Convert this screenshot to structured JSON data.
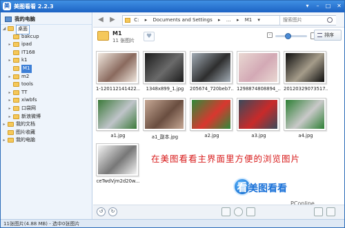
{
  "window": {
    "app_icon_text": "美",
    "title": "美图看看 2.2.3",
    "controls": [
      "▾",
      "–",
      "□",
      "✕"
    ]
  },
  "sidebar": {
    "header": "我的电脑",
    "tree": [
      {
        "label": "桌面",
        "indent": 0,
        "arrow": "◢",
        "state": "hl"
      },
      {
        "label": "bakcup",
        "indent": 1,
        "arrow": "",
        "state": ""
      },
      {
        "label": "ipad",
        "indent": 1,
        "arrow": "▸",
        "state": ""
      },
      {
        "label": "IT168",
        "indent": 1,
        "arrow": "",
        "state": ""
      },
      {
        "label": "k1",
        "indent": 1,
        "arrow": "▸",
        "state": ""
      },
      {
        "label": "M1",
        "indent": 1,
        "arrow": "",
        "state": "sel"
      },
      {
        "label": "m2",
        "indent": 1,
        "arrow": "▸",
        "state": ""
      },
      {
        "label": "tools",
        "indent": 1,
        "arrow": "",
        "state": ""
      },
      {
        "label": "TT",
        "indent": 1,
        "arrow": "▸",
        "state": ""
      },
      {
        "label": "xiwbfs",
        "indent": 1,
        "arrow": "▸",
        "state": ""
      },
      {
        "label": "口袋网",
        "indent": 1,
        "arrow": "▸",
        "state": ""
      },
      {
        "label": "新浪微博",
        "indent": 1,
        "arrow": "▸",
        "state": ""
      },
      {
        "label": "我的文档",
        "indent": 0,
        "arrow": "▸",
        "state": ""
      },
      {
        "label": "图片收藏",
        "indent": 0,
        "arrow": "",
        "state": ""
      },
      {
        "label": "我的电脑",
        "indent": 0,
        "arrow": "▸",
        "state": ""
      }
    ]
  },
  "navigation": {
    "back": "◀",
    "forward": "▶",
    "breadcrumb": [
      "C:",
      "▸",
      "Documents and Settings",
      "▸",
      "…",
      "▸",
      "M1",
      "▾"
    ],
    "search_placeholder": "搜索图片"
  },
  "folder": {
    "name": "M1",
    "count": "11 张图片",
    "heart": "♥",
    "sort_label": "排序",
    "zoom_out": "-"
  },
  "thumbnails": [
    {
      "caption": "1-120112141422...",
      "colors": [
        "#f0e7de",
        "#8a6a5e"
      ]
    },
    {
      "caption": "1348x899_1.jpg",
      "colors": [
        "#1b1b1b",
        "#6a6a6a"
      ]
    },
    {
      "caption": "205674_720beb7...",
      "colors": [
        "#a2acb5",
        "#2e2e2e"
      ]
    },
    {
      "caption": "1298874808894_...",
      "colors": [
        "#e9d8d2",
        "#d3a9b5"
      ]
    },
    {
      "caption": "20120329073517...",
      "colors": [
        "#0d0d0d",
        "#a59c8a"
      ]
    },
    {
      "caption": "a1.jpg",
      "colors": [
        "#3c7a3a",
        "#bfc4c9"
      ]
    },
    {
      "caption": "a1_副本.jpg",
      "colors": [
        "#c6a895",
        "#6a4e40"
      ]
    },
    {
      "caption": "a2.jpg",
      "colors": [
        "#2f8a3a",
        "#d9372f"
      ]
    },
    {
      "caption": "a3.jpg",
      "colors": [
        "#3a4a5a",
        "#c92a2a"
      ]
    },
    {
      "caption": "a4.jpg",
      "colors": [
        "#2d7f34",
        "#c9c9c9"
      ]
    },
    {
      "caption": "ceTwdVjm2d20w...",
      "colors": [
        "#f4f4f4",
        "#777777"
      ]
    }
  ],
  "banner_text": "在美图看看主界面里方便的浏览图片",
  "brand": {
    "bubble": "看",
    "text": "美图看看"
  },
  "watermark": "PConline",
  "bottom_controls": {
    "rotate_left": "↺",
    "rotate_right": "↻"
  },
  "status": "11张图片(4.88 MB) - 选中0张图片"
}
